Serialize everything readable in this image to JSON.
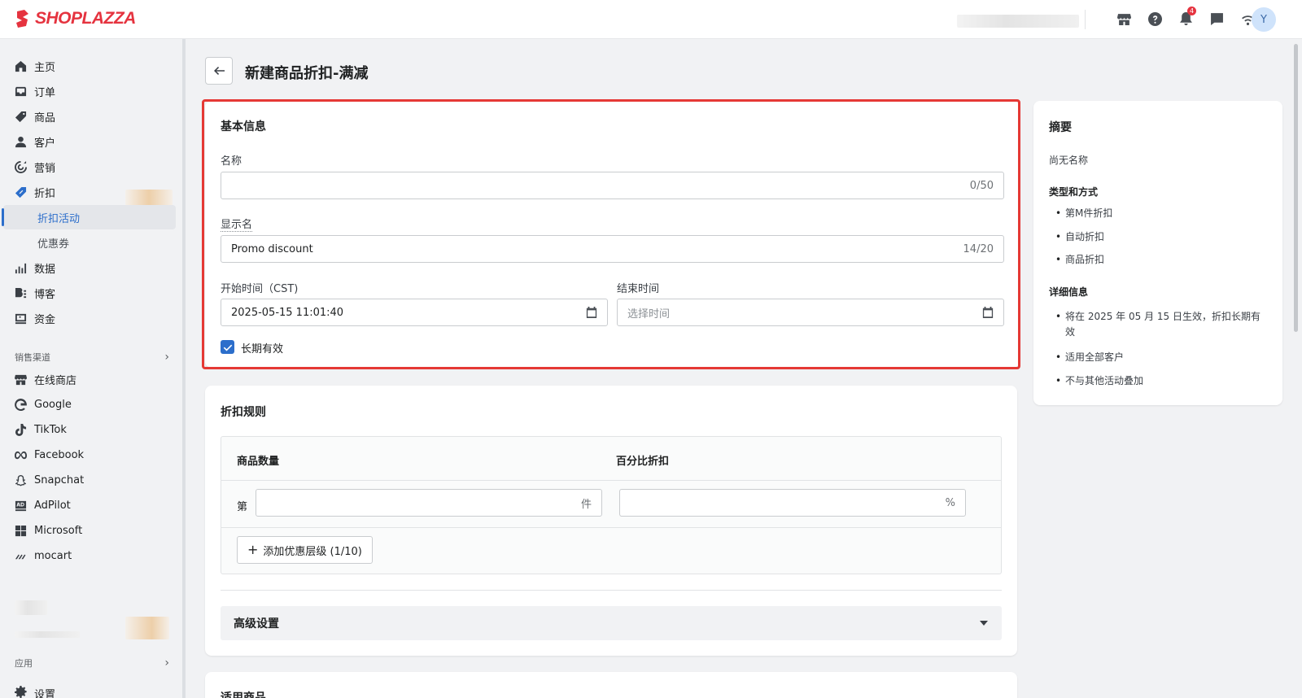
{
  "app": {
    "brand": "SHOPLAZZA",
    "avatar_letter": "Y",
    "notification_count": "4"
  },
  "sidebar": {
    "items": [
      {
        "label": "主页",
        "icon": "home-icon"
      },
      {
        "label": "订单",
        "icon": "inbox-icon"
      },
      {
        "label": "商品",
        "icon": "tag-icon"
      },
      {
        "label": "客户",
        "icon": "person-icon"
      },
      {
        "label": "营销",
        "icon": "target-icon"
      },
      {
        "label": "折扣",
        "icon": "discount-icon"
      }
    ],
    "discount_sub": {
      "active": "折扣活动",
      "other": "优惠券"
    },
    "items2": [
      {
        "label": "数据",
        "icon": "bar-chart-icon"
      },
      {
        "label": "博客",
        "icon": "blog-icon"
      },
      {
        "label": "资金",
        "icon": "finance-icon"
      }
    ],
    "channels_label": "销售渠道",
    "channels": [
      {
        "label": "在线商店",
        "icon": "store-icon"
      },
      {
        "label": "Google",
        "icon": "google-icon"
      },
      {
        "label": "TikTok",
        "icon": "tiktok-icon"
      },
      {
        "label": "Facebook",
        "icon": "meta-icon"
      },
      {
        "label": "Snapchat",
        "icon": "snapchat-icon"
      },
      {
        "label": "AdPilot",
        "icon": "adpilot-icon"
      },
      {
        "label": "Microsoft",
        "icon": "microsoft-icon"
      },
      {
        "label": "mocart",
        "icon": "mocart-icon"
      }
    ],
    "apps_label": "应用",
    "settings_label": "设置"
  },
  "page": {
    "title": "新建商品折扣-满减"
  },
  "basic": {
    "title": "基本信息",
    "name_label": "名称",
    "name_value": "",
    "name_counter": "0/50",
    "display_label": "显示名",
    "display_value": "Promo discount",
    "display_counter": "14/20",
    "start_label": "开始时间（CST)",
    "start_value": "2025-05-15 11:01:40",
    "end_label": "结束时间",
    "end_placeholder": "选择时间",
    "long_term_label": "长期有效",
    "long_term_checked": true
  },
  "rules": {
    "title": "折扣规则",
    "col_qty": "商品数量",
    "col_pct": "百分比折扣",
    "row_prefix": "第",
    "qty_suffix": "件",
    "pct_suffix": "%",
    "add_tier": "添加优惠层级 (1/10)",
    "advanced": "高级设置"
  },
  "applicable": {
    "title": "适用商品"
  },
  "summary": {
    "title": "摘要",
    "no_name": "尚无名称",
    "type_head": "类型和方式",
    "types": [
      "第M件折扣",
      "自动折扣",
      "商品折扣"
    ],
    "detail_head": "详细信息",
    "details": [
      "将在 2025 年 05 月 15 日生效，折扣长期有效",
      "适用全部客户",
      "不与其他活动叠加"
    ]
  },
  "colors": {
    "accent": "#2c6ecb",
    "brand": "#e5333f",
    "highlight": "#e53935"
  }
}
